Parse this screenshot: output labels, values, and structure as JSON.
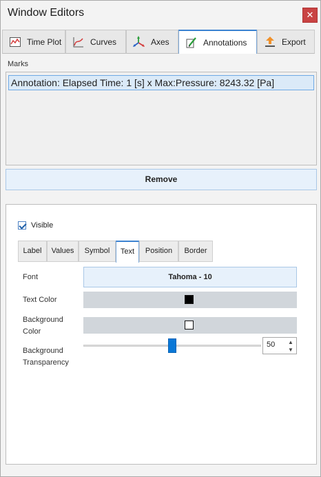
{
  "window": {
    "title": "Window Editors",
    "close_glyph": "✕"
  },
  "tabs": [
    {
      "label": "Time Plot",
      "icon": "time-plot-icon"
    },
    {
      "label": "Curves",
      "icon": "curves-icon"
    },
    {
      "label": "Axes",
      "icon": "axes-icon"
    },
    {
      "label": "Annotations",
      "icon": "annotations-icon",
      "active": true
    },
    {
      "label": "Export",
      "icon": "export-icon"
    }
  ],
  "marks": {
    "label": "Marks",
    "items": [
      "Annotation: Elapsed Time: 1 [s] x Max:Pressure: 8243.32 [Pa]"
    ]
  },
  "remove_label": "Remove",
  "visible": {
    "label": "Visible",
    "checked": true
  },
  "subtabs": [
    {
      "label": "Label"
    },
    {
      "label": "Values"
    },
    {
      "label": "Symbol"
    },
    {
      "label": "Text",
      "active": true
    },
    {
      "label": "Position"
    },
    {
      "label": "Border"
    }
  ],
  "text_props": {
    "font_label": "Font",
    "font_value": "Tahoma - 10",
    "text_color_label": "Text Color",
    "text_color": "#000000",
    "bg_color_label_line1": "Background",
    "bg_color_label_line2": "Color",
    "bg_color": "#ffffff",
    "transparency_label_line1": "Background",
    "transparency_label_line2": "Transparency",
    "transparency_value": "50",
    "transparency_fraction": 0.5
  },
  "colors": {
    "accent": "#3b82d1",
    "slider_thumb": "#0a78d7",
    "close_button": "#c94343",
    "selection_bg": "#dbeaf8"
  }
}
